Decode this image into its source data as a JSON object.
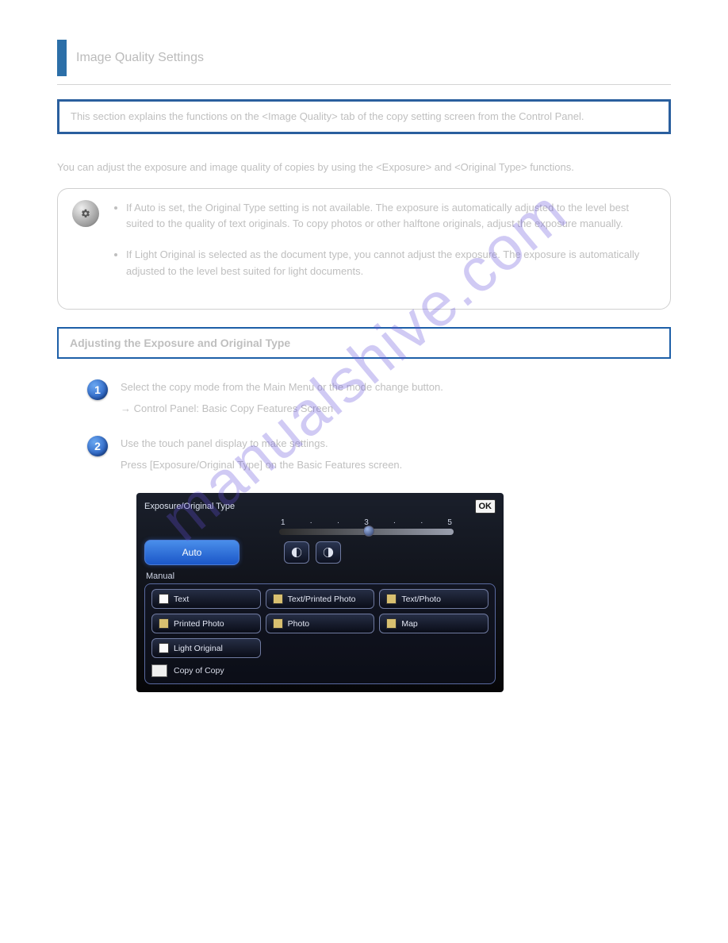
{
  "title": "Image Quality Settings",
  "intro_box": "This section explains the functions on the <Image Quality> tab of the copy setting screen from the Control Panel.",
  "para1": "You can adjust the exposure and image quality of copies by using the <Exposure> and <Original Type> functions.",
  "note": {
    "item1": "If Auto is set, the Original Type setting is not available. The exposure is automatically adjusted to the level best suited to the quality of text originals. To copy photos or other halftone originals, adjust the exposure manually.",
    "item2": "If Light Original is selected as the document type, you cannot adjust the exposure. The exposure is automatically adjusted to the level best suited for light documents."
  },
  "subheader": "Adjusting the Exposure and Original Type",
  "steps": {
    "s1": {
      "line1": "Select the copy mode from the Main Menu or the mode change button.",
      "line2": "→ Control Panel: Basic Copy Features Screen"
    },
    "s2": {
      "line1": "Use the touch panel display to make settings.",
      "line2": "Press [Exposure/Original Type] on the Basic Features screen."
    }
  },
  "panel": {
    "title": "Exposure/Original Type",
    "ok": "OK",
    "slider_marks": [
      "1",
      "·",
      "·",
      "3",
      "·",
      "·",
      "5"
    ],
    "auto": "Auto",
    "manual_label": "Manual",
    "buttons": {
      "text": "Text",
      "text_printed_photo": "Text/Printed Photo",
      "text_photo": "Text/Photo",
      "printed_photo": "Printed Photo",
      "photo": "Photo",
      "map": "Map",
      "light_original": "Light Original"
    },
    "copy_of_copy": "Copy of Copy"
  }
}
